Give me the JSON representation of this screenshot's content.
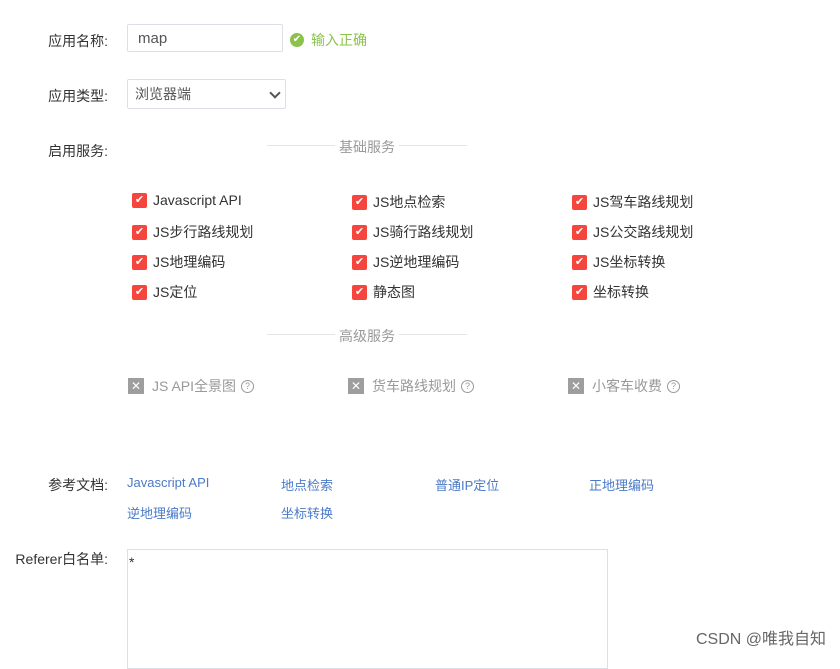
{
  "form": {
    "app_name_label": "应用名称:",
    "app_name_value": "map",
    "validation": "输入正确",
    "app_type_label": "应用类型:",
    "app_type_value": "浏览器端",
    "services_label": "启用服务:",
    "basic_title": "基础服务",
    "basic_services": [
      "Javascript API",
      "JS地点检索",
      "JS驾车路线规划",
      "JS步行路线规划",
      "JS骑行路线规划",
      "JS公交路线规划",
      "JS地理编码",
      "JS逆地理编码",
      "JS坐标转换",
      "JS定位",
      "静态图",
      "坐标转换"
    ],
    "advanced_title": "高级服务",
    "advanced_services": [
      "JS API全景图",
      "货车路线规划",
      "小客车收费"
    ],
    "docs_label": "参考文档:",
    "docs": [
      "Javascript API",
      "地点检索",
      "普通IP定位",
      "正地理编码",
      "逆地理编码",
      "坐标转换"
    ],
    "referer_label": "Referer白名单:",
    "referer_value": "*"
  },
  "watermark": "CSDN @唯我自知",
  "colors": {
    "checked": "#f5453d",
    "success": "#8bc34a",
    "link": "#4a7ac9"
  }
}
